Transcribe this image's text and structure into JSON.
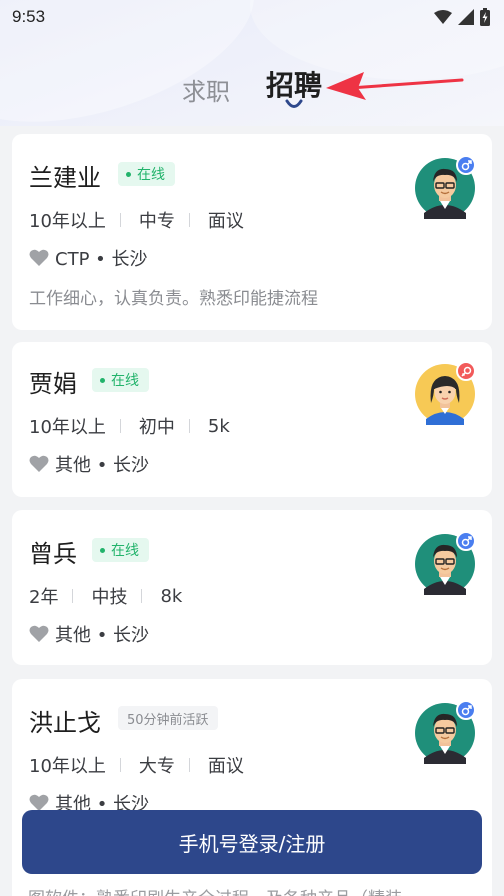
{
  "status_bar": {
    "time": "9:53"
  },
  "tabs": {
    "seek": "求职",
    "hire": "招聘"
  },
  "cards": [
    {
      "name": "兰建业",
      "status": "在线",
      "experience": "10年以上",
      "education": "中专",
      "salary": "面议",
      "job_location": "CTP • 长沙",
      "description": "工作细心，认真负责。熟悉印能捷流程",
      "gender": "male"
    },
    {
      "name": "贾娟",
      "status": "在线",
      "experience": "10年以上",
      "education": "初中",
      "salary": "5k",
      "job_location": "其他 • 长沙",
      "gender": "female"
    },
    {
      "name": "曾兵",
      "status": "在线",
      "experience": "2年",
      "education": "中技",
      "salary": "8k",
      "job_location": "其他 • 长沙",
      "gender": "male"
    },
    {
      "name": "洪止戈",
      "status": "50分钟前活跃",
      "experience": "10年以上",
      "education": "大专",
      "salary": "面议",
      "job_location": "其他 • 长沙",
      "gender": "male"
    }
  ],
  "partial_text": "图软件；熟悉印刷生产全过程，及各种产品（精装",
  "login_button": "手机号登录/注册",
  "colors": {
    "primary": "#2d478b",
    "online_green": "#22b36b",
    "male_blue": "#4a7ef0",
    "female_red": "#f25a5a",
    "arrow_red": "#ee3344"
  }
}
